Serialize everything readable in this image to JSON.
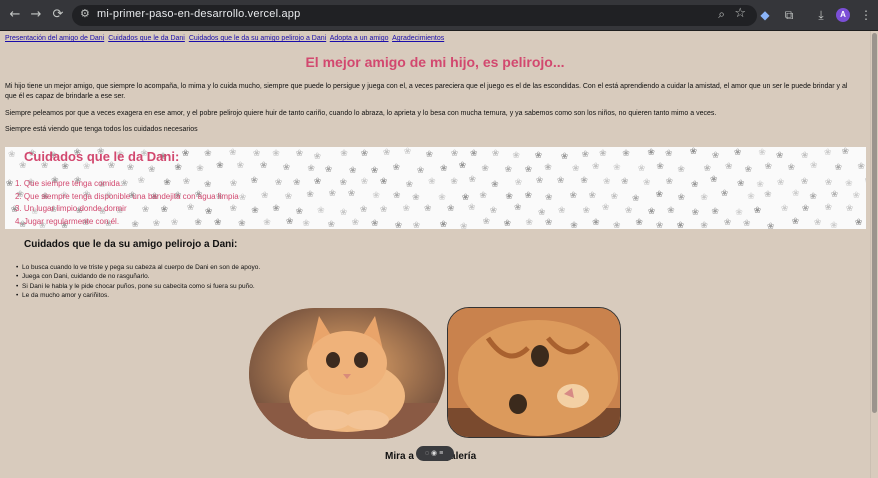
{
  "browser": {
    "url": "mi-primer-paso-en-desarrollo.vercel.app",
    "avatar_letter": "A"
  },
  "nav": [
    "Presentación del amigo de Dani",
    "Cuidados que le da Dani",
    "Cuidados que le da su amigo pelirojo a Dani",
    "Adopta a un amigo",
    "Agradecimientos"
  ],
  "title": "El mejor amigo de mi hijo, es pelirojo...",
  "paragraphs": [
    "Mi hijo tiene un mejor amigo, que siempre lo acompaña, lo mima y lo cuida mucho, siempre que puede lo persigue y juega con el, a veces pareciera que el juego es el de las escondidas. Con el está aprendiendo a cuidar la amistad, el amor que un ser le puede brindar y al que él es capaz de brindarle a ese ser.",
    "Siempre peleamos por que a veces exagera en ese amor, y el pobre pelirojo quiere huir de tanto cariño, cuando lo abraza, lo aprieta y lo besa con mucha ternura, y ya sabemos como son los niños, no quieren tanto mimo a veces.",
    "Siempre está viendo que tenga todos los cuidados necesarios"
  ],
  "care_dani": {
    "heading": "Cuidados que le da Dani:",
    "items": [
      "1. Que siempre tenga comida.",
      "2. Que siempre tenga disponible una bandejita con agua limpia",
      "3. Un lugar limpio donde dormir",
      "4. Jugar regularmente con él."
    ]
  },
  "care_friend": {
    "heading": "Cuidados que le da su amigo pelirojo a Dani:",
    "items": [
      "Lo busca cuando lo ve triste y pega su cabeza al cuerpo de Dani en son de apoyo.",
      "Juega con Dani, cuidando de no rasguñarlo.",
      "Si Dani le habla y le pide chocar puños, pone su cabecita como si fuera su puño.",
      "Le da mucho amor y cariñitos."
    ]
  },
  "gallery_label": "Mira a",
  "gallery_label_end": "galería",
  "colors": {
    "page_bg": "#d8cbbd",
    "accent_pink": "#d2486f"
  }
}
